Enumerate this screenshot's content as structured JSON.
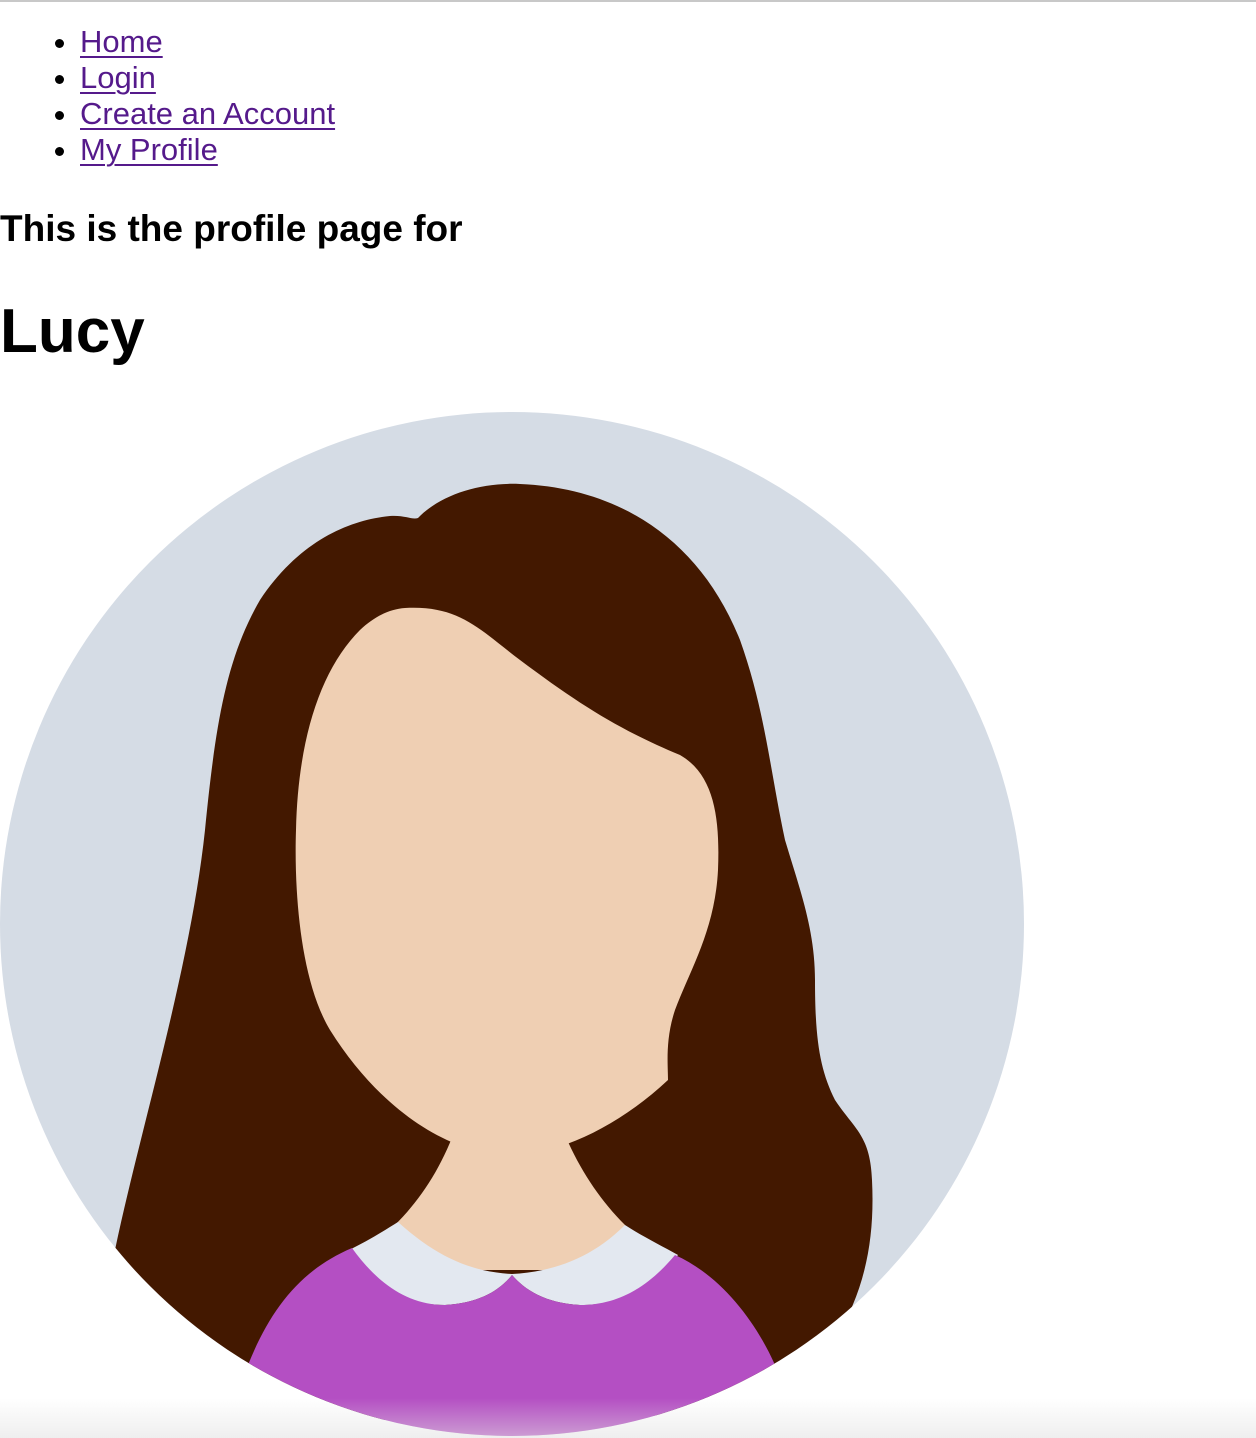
{
  "nav": {
    "items": [
      {
        "label": "Home"
      },
      {
        "label": "Login"
      },
      {
        "label": "Create an Account"
      },
      {
        "label": "My Profile"
      }
    ]
  },
  "profile": {
    "subtitle": "This is the profile page for",
    "name": "Lucy"
  },
  "colors": {
    "link": "#551a8b",
    "avatar_background": "#d5dce5",
    "hair": "#431800",
    "skin": "#efcfb3",
    "collar": "#e3e8f0",
    "shirt": "#b44fc3"
  }
}
